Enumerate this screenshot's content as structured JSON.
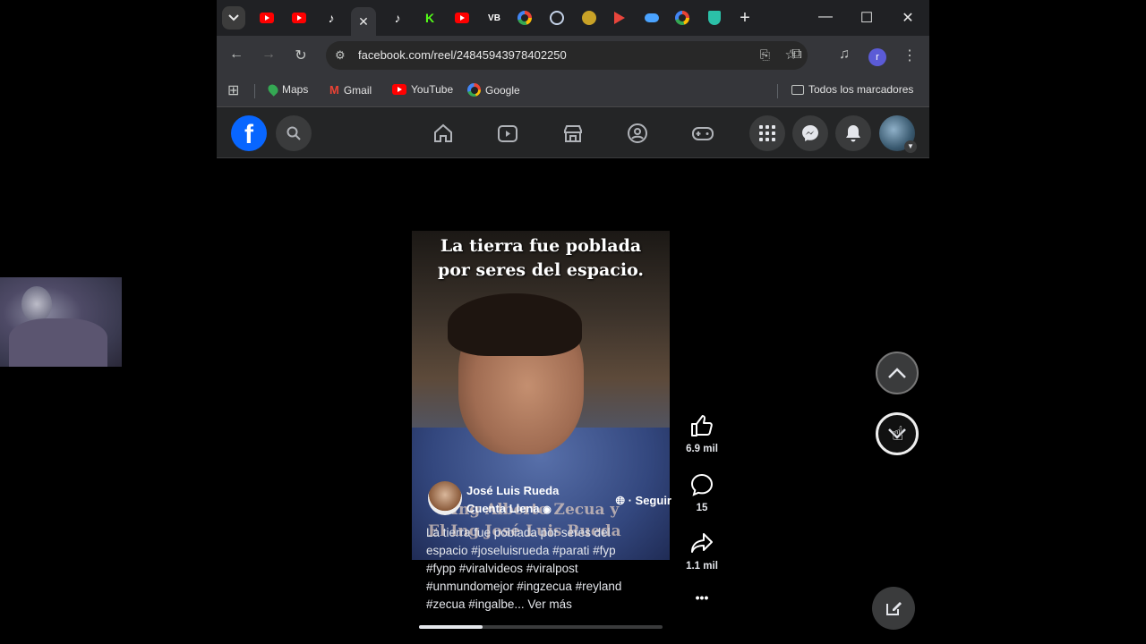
{
  "browser": {
    "url": "facebook.com/reel/24845943978402250",
    "bookmarks": [
      {
        "label": "Maps",
        "icon": "maps-pin-icon"
      },
      {
        "label": "Gmail",
        "icon": "gmail-icon"
      },
      {
        "label": "YouTube",
        "icon": "youtube-icon"
      },
      {
        "label": "Google",
        "icon": "google-icon"
      }
    ],
    "all_bookmarks": "Todos los marcadores",
    "profile_initial": "r",
    "tab_icons": [
      "youtube",
      "youtube",
      "tiktok",
      "close",
      "tiktok",
      "kick",
      "youtube",
      "vb",
      "google",
      "wordpress",
      "monkey",
      "arrow",
      "cloud",
      "google",
      "shield"
    ],
    "vb_label": "VB",
    "kick_label": "K"
  },
  "facebook": {
    "logo": "f"
  },
  "reel": {
    "overlay_title_line1": "La tierra fue poblada",
    "overlay_title_line2": "por seres del espacio.",
    "overlay_sub_line1": "Ing Alberto Zecua y",
    "overlay_sub_line2": "El Ing José Luis Rueda",
    "author_name": "José Luis Rueda",
    "author_account": "Cuenta Llena",
    "follow": "· Seguir",
    "caption_lines": [
      "La tierra fue poblada por seres del",
      "espacio #joseluisrueda #parati #fyp",
      "#fypp #viralvideos #viralpost",
      "#unmundomejor #ingzecua #reyland",
      "#zecua #ingalbe... Ver más"
    ],
    "likes": "6.9 mil",
    "comments": "15",
    "shares": "1.1 mil",
    "more": "•••",
    "progress": 0.26
  },
  "colors": {
    "facebook_blue": "#0866ff",
    "youtube_red": "#ff0000",
    "dark_bg": "#242526"
  }
}
